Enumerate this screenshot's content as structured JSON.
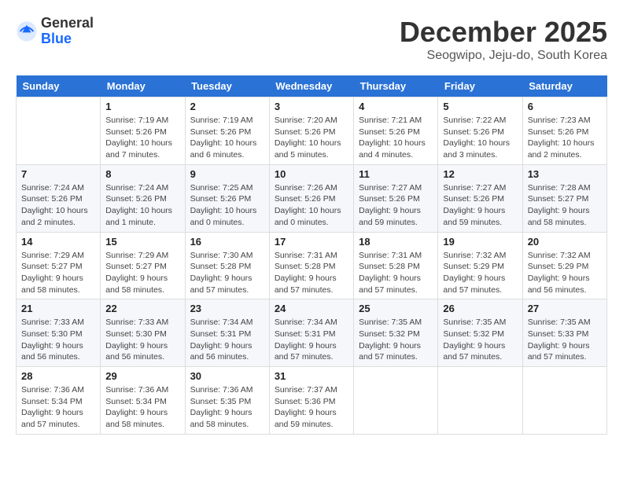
{
  "header": {
    "logo_line1": "General",
    "logo_line2": "Blue",
    "month_title": "December 2025",
    "subtitle": "Seogwipo, Jeju-do, South Korea"
  },
  "weekdays": [
    "Sunday",
    "Monday",
    "Tuesday",
    "Wednesday",
    "Thursday",
    "Friday",
    "Saturday"
  ],
  "weeks": [
    [
      {
        "day": "",
        "info": ""
      },
      {
        "day": "1",
        "info": "Sunrise: 7:19 AM\nSunset: 5:26 PM\nDaylight: 10 hours\nand 7 minutes."
      },
      {
        "day": "2",
        "info": "Sunrise: 7:19 AM\nSunset: 5:26 PM\nDaylight: 10 hours\nand 6 minutes."
      },
      {
        "day": "3",
        "info": "Sunrise: 7:20 AM\nSunset: 5:26 PM\nDaylight: 10 hours\nand 5 minutes."
      },
      {
        "day": "4",
        "info": "Sunrise: 7:21 AM\nSunset: 5:26 PM\nDaylight: 10 hours\nand 4 minutes."
      },
      {
        "day": "5",
        "info": "Sunrise: 7:22 AM\nSunset: 5:26 PM\nDaylight: 10 hours\nand 3 minutes."
      },
      {
        "day": "6",
        "info": "Sunrise: 7:23 AM\nSunset: 5:26 PM\nDaylight: 10 hours\nand 2 minutes."
      }
    ],
    [
      {
        "day": "7",
        "info": "Sunrise: 7:24 AM\nSunset: 5:26 PM\nDaylight: 10 hours\nand 2 minutes."
      },
      {
        "day": "8",
        "info": "Sunrise: 7:24 AM\nSunset: 5:26 PM\nDaylight: 10 hours\nand 1 minute."
      },
      {
        "day": "9",
        "info": "Sunrise: 7:25 AM\nSunset: 5:26 PM\nDaylight: 10 hours\nand 0 minutes."
      },
      {
        "day": "10",
        "info": "Sunrise: 7:26 AM\nSunset: 5:26 PM\nDaylight: 10 hours\nand 0 minutes."
      },
      {
        "day": "11",
        "info": "Sunrise: 7:27 AM\nSunset: 5:26 PM\nDaylight: 9 hours\nand 59 minutes."
      },
      {
        "day": "12",
        "info": "Sunrise: 7:27 AM\nSunset: 5:26 PM\nDaylight: 9 hours\nand 59 minutes."
      },
      {
        "day": "13",
        "info": "Sunrise: 7:28 AM\nSunset: 5:27 PM\nDaylight: 9 hours\nand 58 minutes."
      }
    ],
    [
      {
        "day": "14",
        "info": "Sunrise: 7:29 AM\nSunset: 5:27 PM\nDaylight: 9 hours\nand 58 minutes."
      },
      {
        "day": "15",
        "info": "Sunrise: 7:29 AM\nSunset: 5:27 PM\nDaylight: 9 hours\nand 58 minutes."
      },
      {
        "day": "16",
        "info": "Sunrise: 7:30 AM\nSunset: 5:28 PM\nDaylight: 9 hours\nand 57 minutes."
      },
      {
        "day": "17",
        "info": "Sunrise: 7:31 AM\nSunset: 5:28 PM\nDaylight: 9 hours\nand 57 minutes."
      },
      {
        "day": "18",
        "info": "Sunrise: 7:31 AM\nSunset: 5:28 PM\nDaylight: 9 hours\nand 57 minutes."
      },
      {
        "day": "19",
        "info": "Sunrise: 7:32 AM\nSunset: 5:29 PM\nDaylight: 9 hours\nand 57 minutes."
      },
      {
        "day": "20",
        "info": "Sunrise: 7:32 AM\nSunset: 5:29 PM\nDaylight: 9 hours\nand 56 minutes."
      }
    ],
    [
      {
        "day": "21",
        "info": "Sunrise: 7:33 AM\nSunset: 5:30 PM\nDaylight: 9 hours\nand 56 minutes."
      },
      {
        "day": "22",
        "info": "Sunrise: 7:33 AM\nSunset: 5:30 PM\nDaylight: 9 hours\nand 56 minutes."
      },
      {
        "day": "23",
        "info": "Sunrise: 7:34 AM\nSunset: 5:31 PM\nDaylight: 9 hours\nand 56 minutes."
      },
      {
        "day": "24",
        "info": "Sunrise: 7:34 AM\nSunset: 5:31 PM\nDaylight: 9 hours\nand 57 minutes."
      },
      {
        "day": "25",
        "info": "Sunrise: 7:35 AM\nSunset: 5:32 PM\nDaylight: 9 hours\nand 57 minutes."
      },
      {
        "day": "26",
        "info": "Sunrise: 7:35 AM\nSunset: 5:32 PM\nDaylight: 9 hours\nand 57 minutes."
      },
      {
        "day": "27",
        "info": "Sunrise: 7:35 AM\nSunset: 5:33 PM\nDaylight: 9 hours\nand 57 minutes."
      }
    ],
    [
      {
        "day": "28",
        "info": "Sunrise: 7:36 AM\nSunset: 5:34 PM\nDaylight: 9 hours\nand 57 minutes."
      },
      {
        "day": "29",
        "info": "Sunrise: 7:36 AM\nSunset: 5:34 PM\nDaylight: 9 hours\nand 58 minutes."
      },
      {
        "day": "30",
        "info": "Sunrise: 7:36 AM\nSunset: 5:35 PM\nDaylight: 9 hours\nand 58 minutes."
      },
      {
        "day": "31",
        "info": "Sunrise: 7:37 AM\nSunset: 5:36 PM\nDaylight: 9 hours\nand 59 minutes."
      },
      {
        "day": "",
        "info": ""
      },
      {
        "day": "",
        "info": ""
      },
      {
        "day": "",
        "info": ""
      }
    ]
  ]
}
